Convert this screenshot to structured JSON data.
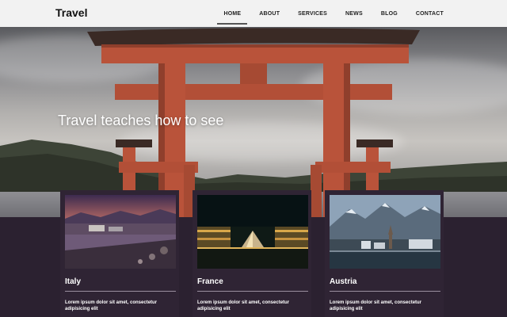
{
  "header": {
    "logo": "Travel",
    "nav": [
      {
        "label": "HOME",
        "active": true
      },
      {
        "label": "ABOUT"
      },
      {
        "label": "SERVICES"
      },
      {
        "label": "NEWS"
      },
      {
        "label": "BLOG"
      },
      {
        "label": "CONTACT"
      }
    ]
  },
  "hero": {
    "title": "Travel teaches how to see"
  },
  "cards": [
    {
      "title": "Italy",
      "text": "Lorem ipsum dolor sit amet, consectetur adipisicing elit"
    },
    {
      "title": "France",
      "text": "Lorem ipsum dolor sit amet, consectetur adipisicing elit"
    },
    {
      "title": "Austria",
      "text": "Lorem ipsum dolor sit amet, consectetur adipisicing elit"
    }
  ],
  "colors": {
    "header_bg": "#f2f2f2",
    "band_bg": "#2b2130",
    "torii": "#b9533a"
  }
}
